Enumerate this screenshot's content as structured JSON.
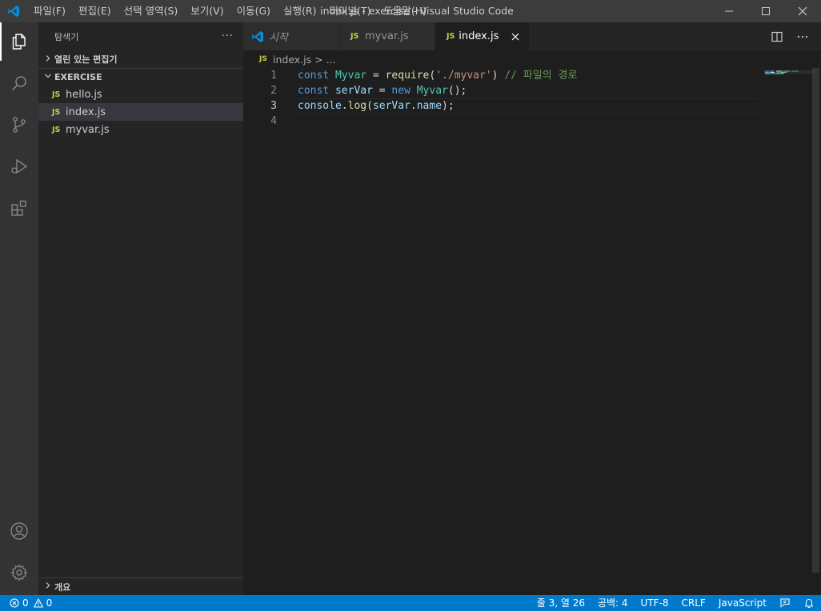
{
  "titlebar": {
    "menus": [
      "파일(F)",
      "편집(E)",
      "선택 영역(S)",
      "보기(V)",
      "이동(G)",
      "실행(R)",
      "터미널(T)",
      "도움말(H)"
    ],
    "title": "index.js - exercise - Visual Studio Code"
  },
  "activitybar": {
    "items": [
      "explorer-icon",
      "search-icon",
      "source-control-icon",
      "run-debug-icon",
      "extensions-icon"
    ],
    "bottom": [
      "account-icon",
      "manage-gear-icon"
    ]
  },
  "sidebar": {
    "title": "탐색기",
    "more": "···",
    "open_editors": "열린 있는 편집기",
    "folder": "EXERCISE",
    "files": [
      {
        "badge": "JS",
        "name": "hello.js"
      },
      {
        "badge": "JS",
        "name": "index.js"
      },
      {
        "badge": "JS",
        "name": "myvar.js"
      }
    ],
    "outline": "개요"
  },
  "tabs": [
    {
      "name": "시작"
    },
    {
      "badge": "JS",
      "name": "myvar.js"
    },
    {
      "badge": "JS",
      "name": "index.js"
    }
  ],
  "breadcrumb": {
    "badge": "JS",
    "file": "index.js",
    "sep": ">",
    "rest": "..."
  },
  "code": {
    "line_numbers": [
      "1",
      "2",
      "3",
      "4"
    ],
    "lines": [
      [
        {
          "t": "const ",
          "c": "kw"
        },
        {
          "t": "Myvar",
          "c": "cls"
        },
        {
          "t": " = ",
          "c": "op"
        },
        {
          "t": "require",
          "c": "fn"
        },
        {
          "t": "(",
          "c": "op"
        },
        {
          "t": "'./myvar'",
          "c": "str"
        },
        {
          "t": ") ",
          "c": "op"
        },
        {
          "t": "// 파일의 경로",
          "c": "cmt"
        }
      ],
      [
        {
          "t": "const ",
          "c": "kw"
        },
        {
          "t": "serVar",
          "c": "var"
        },
        {
          "t": " = ",
          "c": "op"
        },
        {
          "t": "new ",
          "c": "kw"
        },
        {
          "t": "Myvar",
          "c": "cls"
        },
        {
          "t": "();",
          "c": "op"
        }
      ],
      [
        {
          "t": "console",
          "c": "var"
        },
        {
          "t": ".",
          "c": "op"
        },
        {
          "t": "log",
          "c": "fn"
        },
        {
          "t": "(",
          "c": "op"
        },
        {
          "t": "serVar",
          "c": "var"
        },
        {
          "t": ".",
          "c": "op"
        },
        {
          "t": "name",
          "c": "var"
        },
        {
          "t": ");",
          "c": "op"
        }
      ],
      []
    ]
  },
  "statusbar": {
    "errors": "0",
    "warnings": "0",
    "position": "줄 3, 열 26",
    "spaces": "공백: 4",
    "encoding": "UTF-8",
    "eol": "CRLF",
    "language": "JavaScript"
  },
  "colors": {
    "accent": "#007acc",
    "js_badge": "#cbcb41",
    "vscode_blue": "#0a8bd6"
  }
}
